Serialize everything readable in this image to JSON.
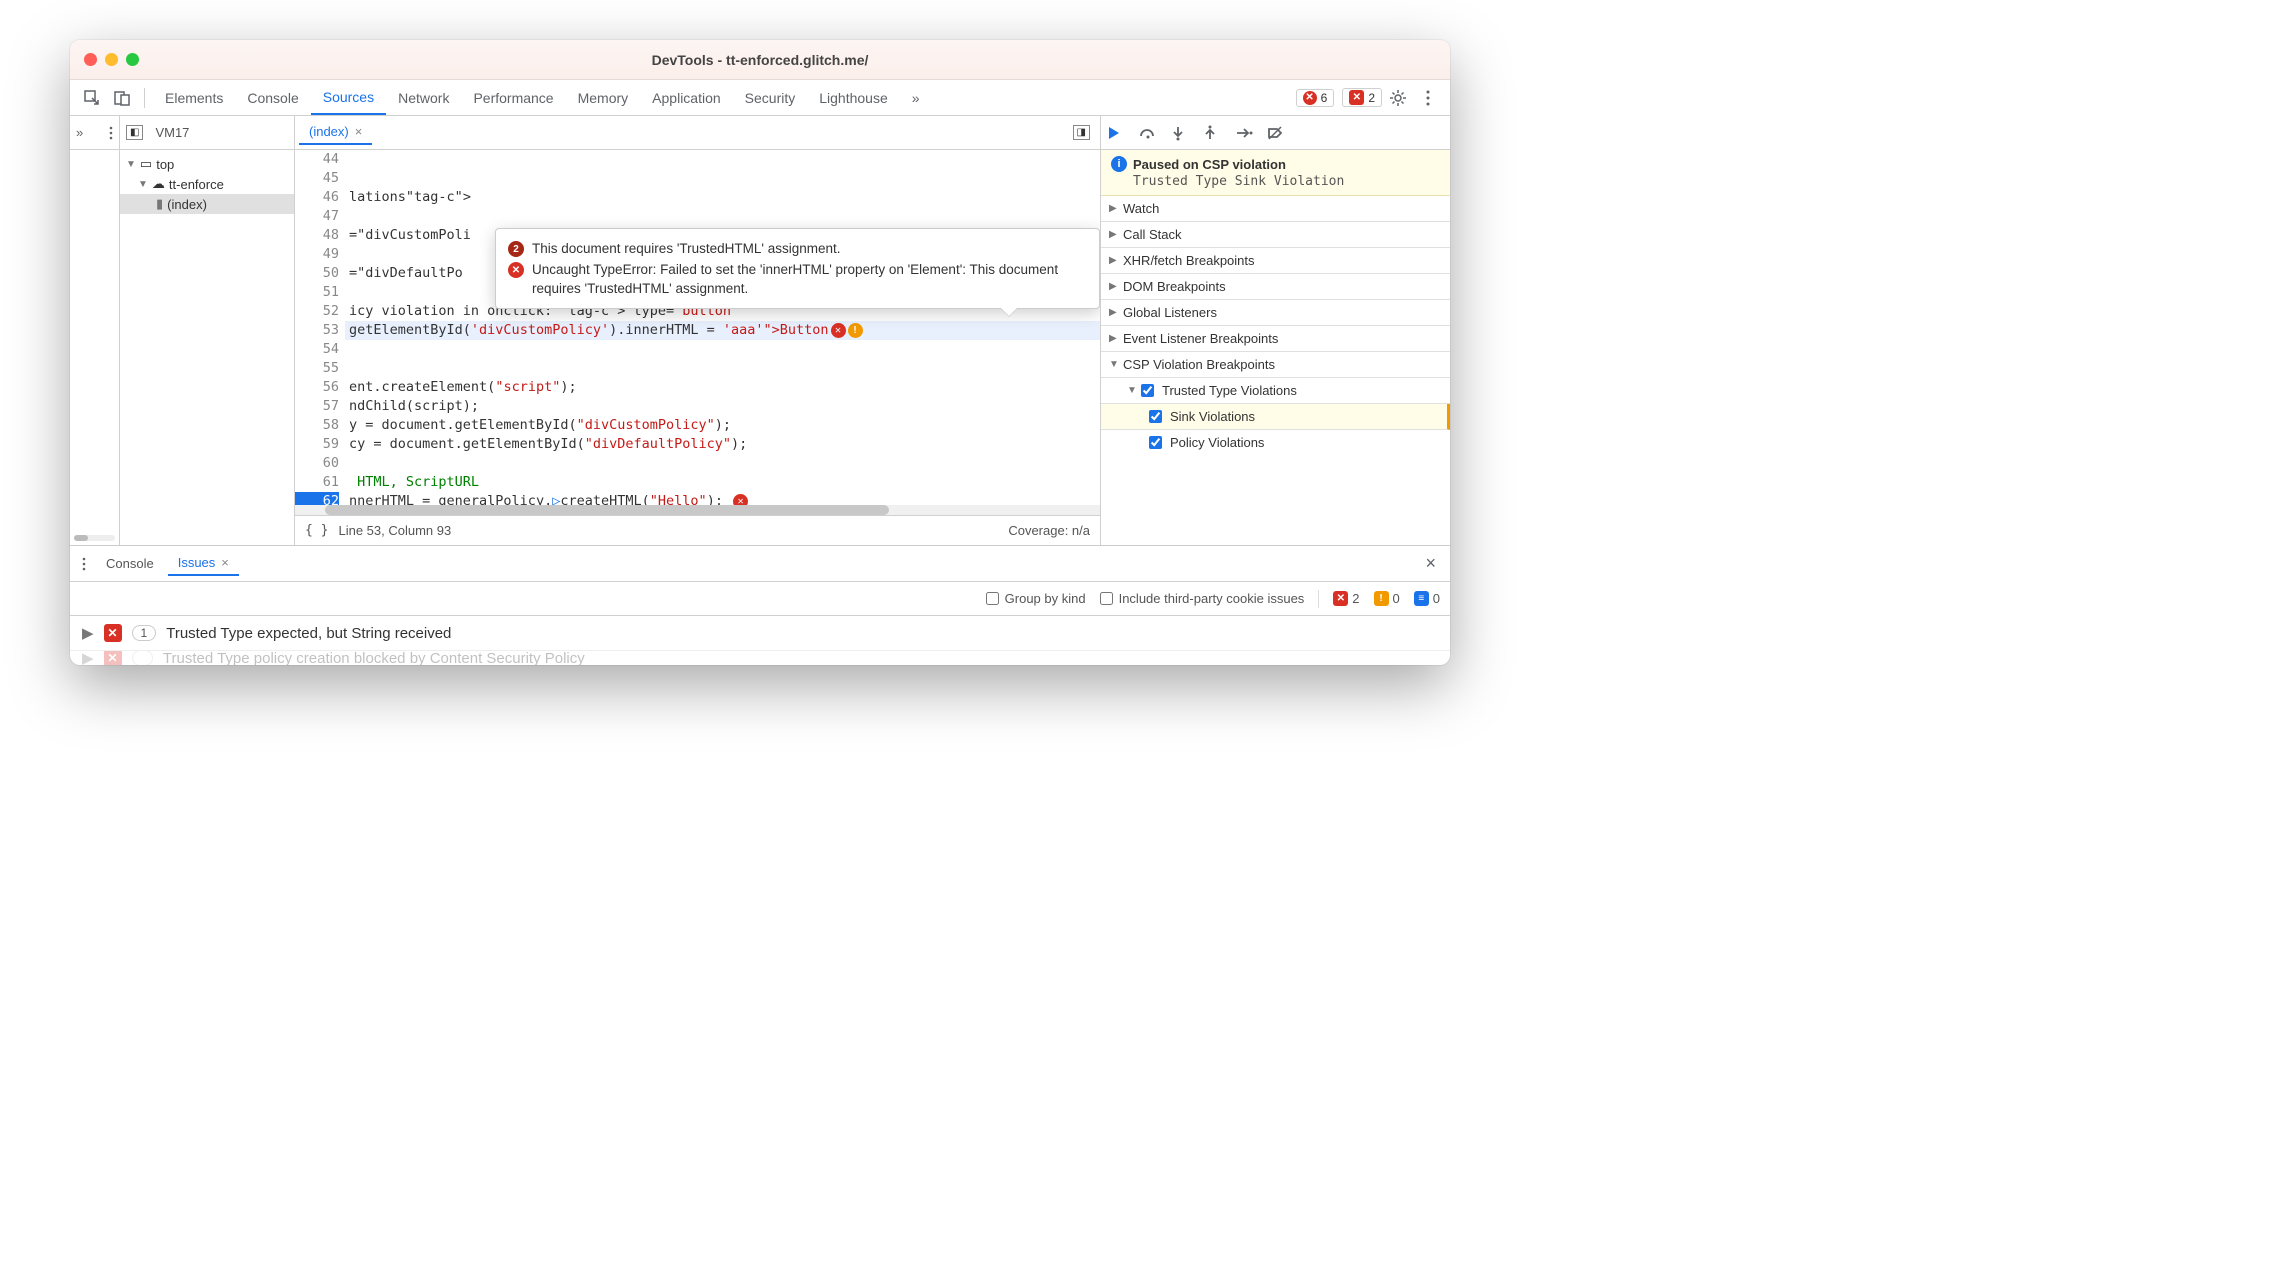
{
  "window": {
    "title": "DevTools - tt-enforced.glitch.me/"
  },
  "toolbar": {
    "tabs": [
      "Elements",
      "Console",
      "Sources",
      "Network",
      "Performance",
      "Memory",
      "Application",
      "Security",
      "Lighthouse"
    ],
    "active_tab": "Sources",
    "errors_count": "6",
    "issues_count": "2"
  },
  "nav": {
    "top": "top",
    "site": "tt-enforce",
    "file": "(index)"
  },
  "editor": {
    "tabs": [
      {
        "label": "VM17",
        "active": false,
        "closable": false
      },
      {
        "label": "(index)",
        "active": true,
        "closable": true
      }
    ],
    "status_line": "Line 53, Column 93",
    "status_coverage": "Coverage: n/a",
    "first_line": 44,
    "lines": [
      "",
      "",
      "lations</h1>",
      "",
      "=\"divCustomPoli",
      "",
      "=\"divDefaultPo",
      "",
      "icy violation in onclick: <button type=\"button\"",
      "getElementById('divCustomPolicy').innerHTML = 'aaa'\">Button</button>",
      "",
      "",
      "ent.createElement(\"script\");",
      "ndChild(script);",
      "y = document.getElementById(\"divCustomPolicy\");",
      "cy = document.getElementById(\"divDefaultPolicy\");",
      "",
      " HTML, ScriptURL",
      "nnerHTML = generalPolicy.createHTML(\"Hello\");"
    ],
    "exec_line": 53,
    "current_line": 62
  },
  "tooltip": {
    "count": "2",
    "msg1": "This document requires 'TrustedHTML' assignment.",
    "msg2": "Uncaught TypeError: Failed to set the 'innerHTML' property on 'Element': This document requires 'TrustedHTML' assignment."
  },
  "debugger": {
    "paused_title": "Paused on CSP violation",
    "paused_sub": "Trusted Type Sink Violation",
    "panels": {
      "watch": "Watch",
      "callstack": "Call Stack",
      "xhr": "XHR/fetch Breakpoints",
      "dom": "DOM Breakpoints",
      "globals": "Global Listeners",
      "evt": "Event Listener Breakpoints",
      "csp": "CSP Violation Breakpoints",
      "tt": "Trusted Type Violations",
      "sink": "Sink Violations",
      "policy": "Policy Violations"
    }
  },
  "drawer": {
    "console_tab": "Console",
    "issues_tab": "Issues",
    "group_by_kind": "Group by kind",
    "include_3p": "Include third-party cookie issues",
    "counts": {
      "err": "2",
      "warn": "0",
      "info": "0"
    },
    "issues": [
      {
        "text": "Trusted Type expected, but String received",
        "count": "1"
      },
      {
        "text": "Trusted Type policy creation blocked by Content Security Policy",
        "count": ""
      }
    ]
  }
}
